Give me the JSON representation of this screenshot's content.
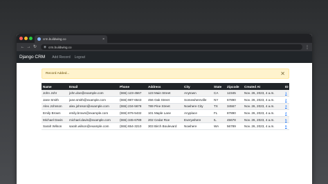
{
  "browser": {
    "tab_title": "crm.buildwing.co",
    "address": "crm.buildwing.co"
  },
  "app": {
    "brand": "Django CRM",
    "nav": [
      {
        "label": "Add Record"
      },
      {
        "label": "Logout"
      }
    ]
  },
  "alert": {
    "message": "Record Added...",
    "close_glyph": "✕"
  },
  "table": {
    "columns": [
      "Name",
      "Email",
      "Phone",
      "Address",
      "City",
      "State",
      "Zipcode",
      "Created At",
      "ID"
    ],
    "rows": [
      [
        "John Johr",
        "john.doe@example.com",
        "(555) 123-4567",
        "123 Main Street",
        "Anytown",
        "CA",
        "12345",
        "Nov. 26, 2023, 4 a.m.",
        "1"
      ],
      [
        "Jane Smith",
        "jane.smith@example.com",
        "(555) 987-6543",
        "456 Oak Street",
        "Somewhereville",
        "NY",
        "67890",
        "Nov. 26, 2023, 4 a.m.",
        "2"
      ],
      [
        "Alex Johnson",
        "alex.johnson@example.com",
        "(555) 234-5678",
        "789 Pine Street",
        "Nowhere City",
        "TX",
        "34567",
        "Nov. 26, 2023, 4 a.m.",
        "3"
      ],
      [
        "Emily Brown",
        "emily.brown@example.com",
        "(555) 876-5432",
        "101 Maple Lane",
        "Anyplace",
        "FL",
        "87890",
        "Nov. 26, 2023, 4 a.m.",
        "4"
      ],
      [
        "Michael Davis",
        "michael.davis@example.com",
        "(555) 345-6789",
        "202 Cedar Roe",
        "Everywhere",
        "IL",
        "45678",
        "Nov. 26, 2023, 4 a.m.",
        "5"
      ],
      [
        "Sarah Wilson",
        "sarah.wilson@example.com",
        "(555) 654-3210",
        "303 Birch Boulevard",
        "Nowhere",
        "WA",
        "56789",
        "Nov. 26, 2023, 4 a.m.",
        "6"
      ]
    ]
  }
}
